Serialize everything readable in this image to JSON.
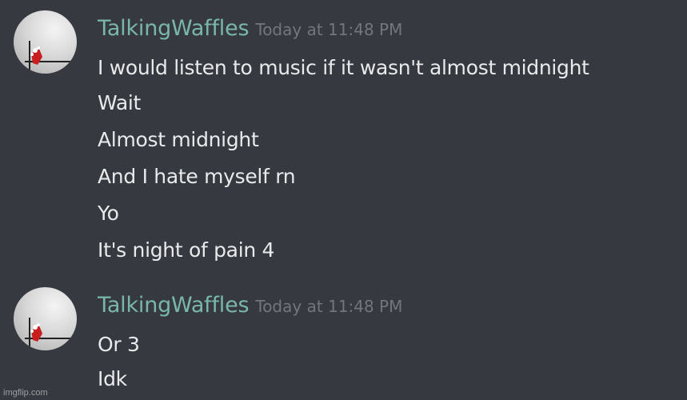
{
  "messages": [
    {
      "username": "TalkingWaffles",
      "timestamp": "Today at 11:48 PM",
      "lines": [
        "I would listen to music if it wasn't almost midnight",
        "Wait",
        "Almost midnight",
        "And I hate myself rn",
        "Yo",
        "It's night of pain 4"
      ]
    },
    {
      "username": "TalkingWaffles",
      "timestamp": "Today at 11:48 PM",
      "lines": [
        "Or 3",
        "Idk"
      ]
    }
  ],
  "watermark": "imgflip.com",
  "colors": {
    "background": "#36393f",
    "username": "#7ab7ab",
    "timestamp": "#72767d",
    "message_text": "#e9eaeb"
  },
  "icons": {
    "avatar": "avatar-drawing-icon"
  }
}
